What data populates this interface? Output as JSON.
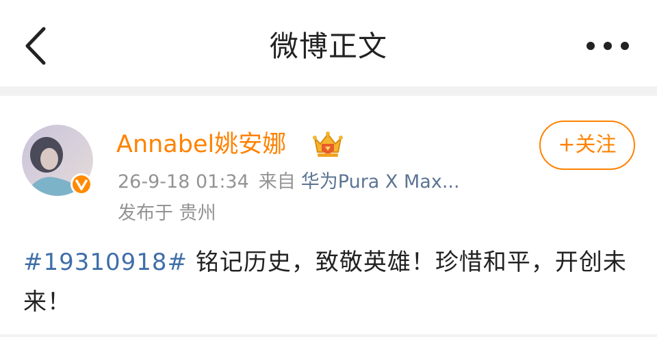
{
  "navbar": {
    "title": "微博正文",
    "back_icon": "chevron-left-icon",
    "more_icon": "more-dots-icon"
  },
  "post": {
    "username": "Annabel姚安娜",
    "timestamp": "26-9-18 01:34",
    "source_prefix": "来自",
    "source_device": "华为Pura X Max...",
    "location": "发布于 贵州",
    "follow_label": "+关注",
    "hashtag": "#19310918#",
    "body": " 铭记历史，致敬英雄！珍惜和平，开创未来！"
  },
  "colors": {
    "accent_orange": "#ff8200",
    "link_blue": "#3e6ea8",
    "source_blue": "#5b7493",
    "meta_gray": "#939393",
    "text_dark": "#222222",
    "separator_gray": "#f2f2f2"
  }
}
